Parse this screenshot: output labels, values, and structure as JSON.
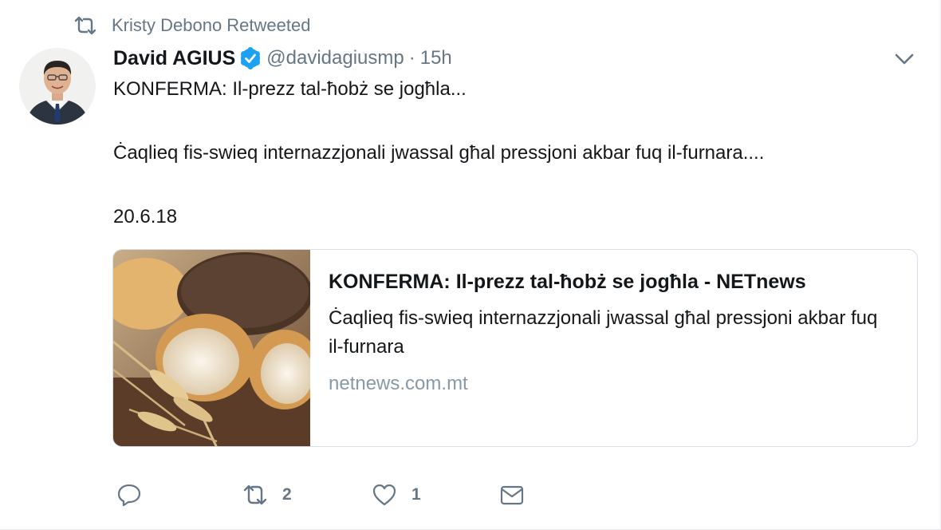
{
  "context": {
    "label": "Kristy Debono Retweeted",
    "icon": "retweet-icon"
  },
  "author": {
    "name": "David AGIUS",
    "handle": "@davidagiusmp",
    "separator": "·",
    "time": "15h",
    "verified_icon": "verified-badge-icon"
  },
  "tweet": {
    "line1": "KONFERMA: Il-prezz tal-ħobż se jogħla...",
    "line2": "Ċaqlieq fis-swieq internazzjonali jwassal għal pressjoni akbar fuq il-furnara....",
    "line3": "20.6.18"
  },
  "card": {
    "title": "KONFERMA: Il-prezz tal-ħobż se jogħla - NETnews",
    "description": "Ċaqlieq fis-swieq internazzjonali jwassal għal pressjoni akbar fuq il-furnara",
    "domain": "netnews.com.mt",
    "image_icon": "bread-photo"
  },
  "actions": {
    "reply_icon": "reply-icon",
    "retweet_icon": "retweet-icon",
    "retweet_count": "2",
    "like_icon": "heart-icon",
    "like_count": "1",
    "dm_icon": "envelope-icon"
  },
  "colors": {
    "text": "#14171a",
    "secondary": "#657786",
    "verified": "#1da1f2",
    "border": "#d6dfe6"
  }
}
